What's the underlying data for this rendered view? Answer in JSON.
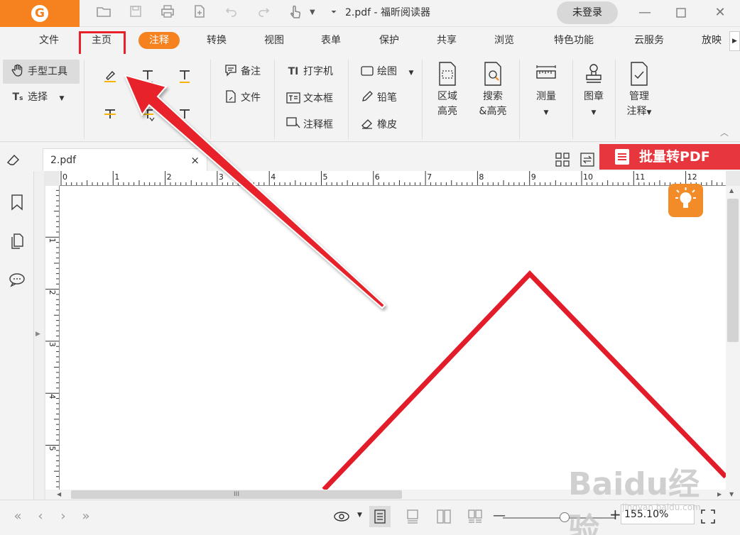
{
  "app": {
    "document_title": "2.pdf - 福昕阅读器",
    "login_label": "未登录"
  },
  "menu_tabs": [
    {
      "label": "文件"
    },
    {
      "label": "主页"
    },
    {
      "label": "注释"
    },
    {
      "label": "转换"
    },
    {
      "label": "视图"
    },
    {
      "label": "表单"
    },
    {
      "label": "保护"
    },
    {
      "label": "共享"
    },
    {
      "label": "浏览"
    },
    {
      "label": "特色功能"
    },
    {
      "label": "云服务"
    },
    {
      "label": "放映"
    }
  ],
  "ribbon": {
    "hand_tool": "手型工具",
    "select": "选择",
    "note": "备注",
    "file": "文件",
    "typewriter": "打字机",
    "textbox": "文本框",
    "callout": "注释框",
    "drawing": "绘图",
    "pencil": "铅笔",
    "eraser": "橡皮",
    "area_highlight": [
      "区域",
      "高亮"
    ],
    "search_highlight": [
      "搜索",
      "&高亮"
    ],
    "measure": "测量",
    "stamp": "图章",
    "manage": [
      "管理",
      "注释"
    ]
  },
  "doc_tab": {
    "name": "2.pdf",
    "close": "×"
  },
  "batch_convert": "批量转PDF",
  "ruler": {
    "h_labels": [
      "0",
      "1",
      "2",
      "3",
      "4",
      "5",
      "6",
      "7",
      "8",
      "9",
      "10",
      "11",
      "12"
    ],
    "v_labels": [
      "1",
      "2",
      "3",
      "4",
      "5"
    ]
  },
  "status": {
    "zoom": "155.10%"
  },
  "watermark": {
    "text": "Baidu经验",
    "sub": "jingyan.baidu.com"
  },
  "colors": {
    "accent": "#f5821f",
    "highlight_red": "#e8202a",
    "batch_red": "#e8363f",
    "shape_red": "#e31c2a"
  }
}
